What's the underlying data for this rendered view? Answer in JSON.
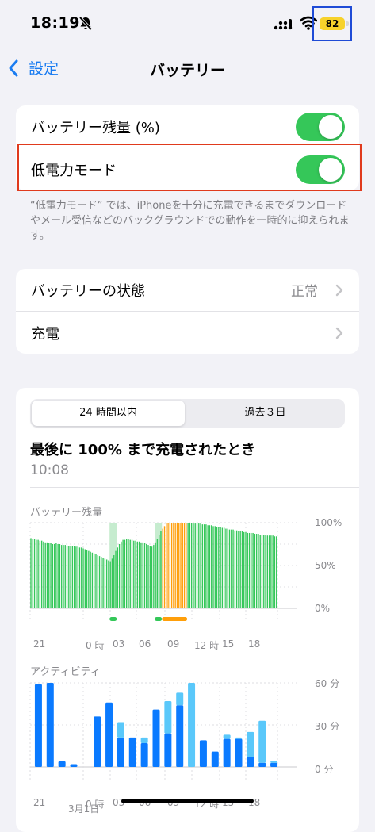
{
  "status": {
    "time": "18:19",
    "battery_level": "82"
  },
  "nav": {
    "back_label": "設定",
    "title": "バッテリー"
  },
  "settings": {
    "battery_percentage": {
      "label": "バッテリー残量 (%)",
      "enabled": true
    },
    "low_power_mode": {
      "label": "低電力モード",
      "enabled": true
    },
    "low_power_footnote": "“低電力モード” では、iPhoneを十分に充電できるまでダウンロードやメール受信などのバックグラウンドでの動作を一時的に抑えられます。"
  },
  "health": {
    "label": "バッテリーの状態",
    "value": "正常",
    "charging_label": "充電"
  },
  "usage": {
    "tabs": [
      "24 時間以内",
      "過去３日"
    ],
    "active_tab": 0,
    "last_charged_label": "最後に 100% まで充電されたとき",
    "last_charged_time": "10:08",
    "level_chart_label": "バッテリー残量",
    "level_y_ticks": [
      "100%",
      "50%",
      "0%"
    ],
    "activity_chart_label": "アクティビティ",
    "activity_y_ticks": [
      "60 分",
      "30 分",
      "0 分"
    ],
    "x_ticks": [
      "21",
      "0 時",
      "03",
      "06",
      "09",
      "12 時",
      "15",
      "18"
    ],
    "date_label": "3月1日"
  },
  "chart_data": [
    {
      "type": "bar",
      "title": "バッテリー残量",
      "ylim": [
        0,
        100
      ],
      "y_unit": "%",
      "values": [
        82,
        81,
        81,
        80,
        80,
        79,
        79,
        78,
        77,
        77,
        76,
        76,
        75,
        75,
        76,
        75,
        75,
        74,
        74,
        74,
        73,
        73,
        73,
        73,
        73,
        72,
        72,
        71,
        71,
        70,
        69,
        68,
        67,
        66,
        65,
        64,
        63,
        62,
        61,
        60,
        59,
        58,
        57,
        56,
        55,
        58,
        62,
        67,
        71,
        75,
        78,
        80,
        80,
        81,
        81,
        80,
        80,
        79,
        79,
        78,
        78,
        77,
        77,
        76,
        75,
        74,
        73,
        72,
        74,
        77,
        81,
        86,
        90,
        93,
        96,
        99,
        100,
        100,
        100,
        100,
        100,
        100,
        100,
        100,
        100,
        100,
        100,
        100,
        100,
        100,
        99,
        99,
        99,
        99,
        99,
        98,
        98,
        98,
        97,
        97,
        97,
        96,
        96,
        95,
        95,
        95,
        94,
        94,
        93,
        93,
        92,
        92,
        92,
        91,
        91,
        90,
        90,
        90,
        89,
        89,
        88,
        88,
        88,
        88,
        87,
        87,
        87,
        86,
        86,
        86,
        86,
        85,
        85,
        85,
        85,
        84,
        84
      ],
      "charging_bands": [
        [
          44,
          48
        ],
        [
          69,
          73
        ]
      ],
      "low_power_band": [
        73,
        87
      ],
      "colors": {
        "normal": "#34c759",
        "charging": "#c6eccf",
        "low_power": "#ff9f0a"
      }
    },
    {
      "type": "bar",
      "title": "アクティビティ",
      "ylim": [
        0,
        60
      ],
      "y_unit": "分",
      "series": [
        {
          "name": "screen_on",
          "color": "#0a7aff",
          "values": [
            59,
            60,
            4,
            2,
            0,
            36,
            46,
            21,
            21,
            17,
            41,
            24,
            44,
            0,
            19,
            11,
            20,
            20,
            7,
            3,
            3
          ]
        },
        {
          "name": "screen_off",
          "color": "#5ac8fa",
          "values": [
            0,
            0,
            0,
            0,
            0,
            0,
            0,
            11,
            0,
            4,
            0,
            23,
            9,
            60,
            0,
            0,
            3,
            1,
            18,
            30,
            1
          ]
        }
      ]
    }
  ]
}
